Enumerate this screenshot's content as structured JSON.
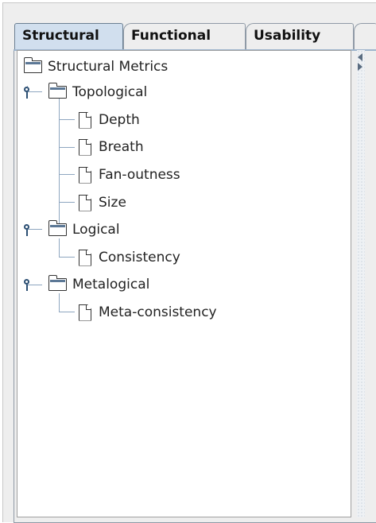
{
  "tabs": [
    {
      "label": "Structural"
    },
    {
      "label": "Functional"
    },
    {
      "label": "Usability"
    }
  ],
  "tree": {
    "root": {
      "label": "Structural Metrics"
    },
    "topological": {
      "label": "Topological",
      "children": [
        "Depth",
        "Breath",
        "Fan-outness",
        "Size"
      ]
    },
    "logical": {
      "label": "Logical",
      "children": [
        "Consistency"
      ]
    },
    "metalogical": {
      "label": "Metalogical",
      "children": [
        "Meta-consistency"
      ]
    }
  },
  "colors": {
    "selected_tab": "#d1dfee",
    "tree_handle": "#2c4f73",
    "folder_accent": "#5c7896"
  },
  "icons": {
    "folder": "folder-icon",
    "file": "file-icon",
    "expand_handle": "expand-handle-icon"
  }
}
